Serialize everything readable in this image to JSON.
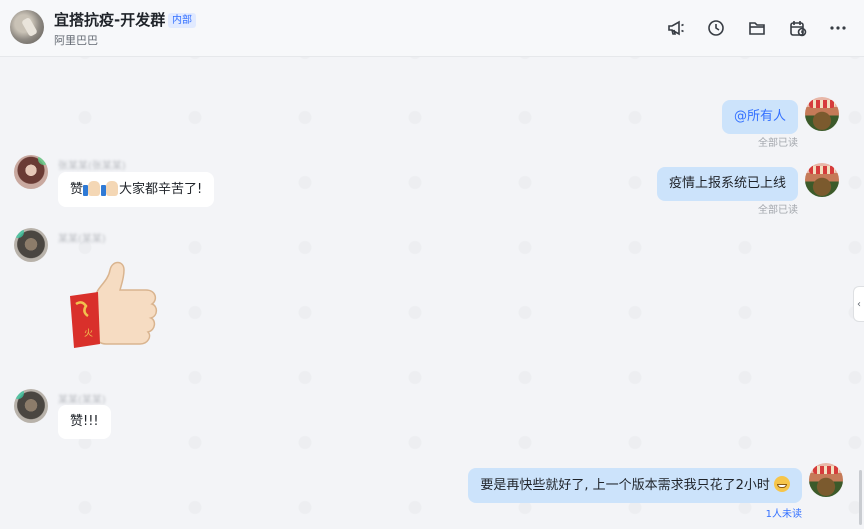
{
  "header": {
    "title": "宜搭抗疫-开发群",
    "badge": "内部",
    "subtitle": "阿里巴巴",
    "icons": [
      "announcement-icon",
      "history-icon",
      "folder-icon",
      "calendar-icon",
      "more-icon"
    ]
  },
  "messages": [
    {
      "side": "out",
      "text": "@所有人",
      "receipt": "全部已读"
    },
    {
      "side": "in",
      "sender": "张某某(张某某)",
      "text_prefix": "赞",
      "text_suffix": "大家都辛苦了!"
    },
    {
      "side": "out",
      "text": "疫情上报系统已上线",
      "receipt": "全部已读"
    },
    {
      "side": "in",
      "sender": "某某(某某)",
      "sticker": "thumbs-up-sticker",
      "sticker_text": "火"
    },
    {
      "side": "in",
      "sender": "某某(某某)",
      "text": "赞!!!"
    },
    {
      "side": "out",
      "text": "要是再快些就好了, 上一个版本需求我只花了2小时",
      "receipt": "1人未读"
    }
  ],
  "colors": {
    "bubble_out": "#cce3fb",
    "bubble_in": "#ffffff",
    "accent": "#3370ff"
  }
}
